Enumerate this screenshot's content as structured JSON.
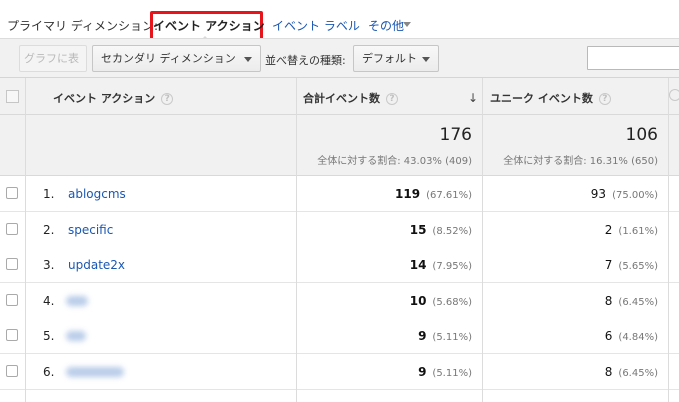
{
  "dimension_bar": {
    "primary_label": "プライマリ ディメンション:",
    "active": "イベント アクション",
    "option_label": "イベント ラベル",
    "more": "その他"
  },
  "toolbar": {
    "graph_button": "グラフに表示",
    "secondary_dimension": "セカンダリ ディメンション",
    "sort_label": "並べ替えの種類:",
    "sort_value": "デフォルト",
    "search_placeholder": ""
  },
  "table": {
    "headers": {
      "dimension": "イベント アクション",
      "total_events": "合計イベント数",
      "unique_events": "ユニーク イベント数"
    },
    "totals": {
      "total_events": "176",
      "total_events_sub": "全体に対する割合: 43.03% (409)",
      "unique_events": "106",
      "unique_events_sub": "全体に対する割合: 16.31% (650)"
    },
    "rows": [
      {
        "num": "1.",
        "name": "ablogcms",
        "total": "119",
        "total_pct": "(67.61%)",
        "unique": "93",
        "unique_pct": "(75.00%)"
      },
      {
        "num": "2.",
        "name": "specific",
        "total": "15",
        "total_pct": "(8.52%)",
        "unique": "2",
        "unique_pct": "(1.61%)"
      },
      {
        "num": "3.",
        "name": "update2x",
        "total": "14",
        "total_pct": "(7.95%)",
        "unique": "7",
        "unique_pct": "(5.65%)"
      },
      {
        "num": "4.",
        "name": "",
        "total": "10",
        "total_pct": "(5.68%)",
        "unique": "8",
        "unique_pct": "(6.45%)"
      },
      {
        "num": "5.",
        "name": "",
        "total": "9",
        "total_pct": "(5.11%)",
        "unique": "6",
        "unique_pct": "(4.84%)"
      },
      {
        "num": "6.",
        "name": "",
        "total": "9",
        "total_pct": "(5.11%)",
        "unique": "8",
        "unique_pct": "(6.45%)"
      }
    ]
  },
  "icons": {
    "help": "?",
    "sort_desc": "↓"
  }
}
